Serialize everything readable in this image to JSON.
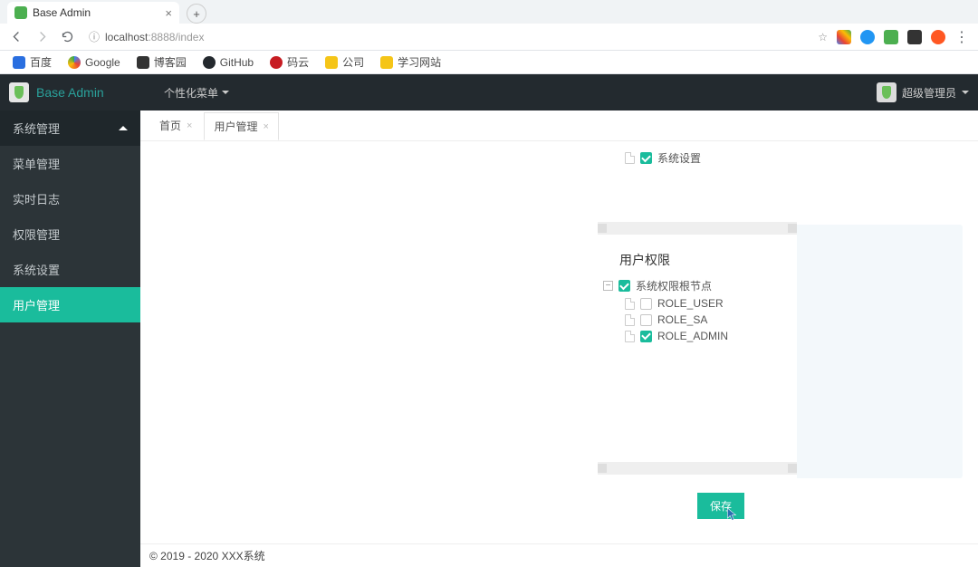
{
  "browser": {
    "tab_title": "Base Admin",
    "url_host": "localhost",
    "url_port_path": ":8888/index",
    "bookmarks": [
      "百度",
      "Google",
      "博客园",
      "GitHub",
      "码云",
      "公司",
      "学习网站"
    ]
  },
  "header": {
    "brand": "Base Admin",
    "personal_menu": "个性化菜单",
    "user_label": "超级管理员"
  },
  "sidebar": {
    "group": "系统管理",
    "items": [
      "菜单管理",
      "实时日志",
      "权限管理",
      "系统设置",
      "用户管理"
    ],
    "active_index": 4
  },
  "tabs": {
    "items": [
      "首页",
      "用户管理"
    ],
    "active_index": 1
  },
  "top_tree": {
    "item_label": "系统设置",
    "item_checked": true
  },
  "perm_panel": {
    "title": "用户权限",
    "root_label": "系统权限根节点",
    "root_checked": true,
    "roles": [
      {
        "name": "ROLE_USER",
        "checked": false
      },
      {
        "name": "ROLE_SA",
        "checked": false
      },
      {
        "name": "ROLE_ADMIN",
        "checked": true
      }
    ],
    "save_label": "保存"
  },
  "footer": {
    "copyright": "© 2019 - 2020 XXX系统"
  }
}
